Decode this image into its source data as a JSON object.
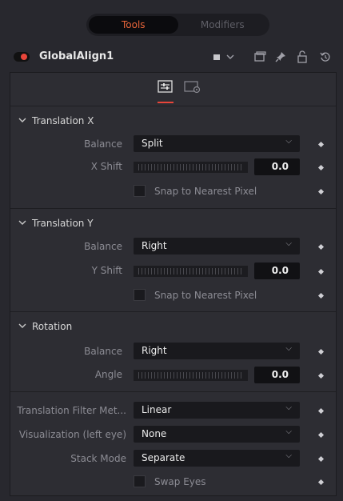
{
  "tabs": {
    "tools": "Tools",
    "modifiers": "Modifiers"
  },
  "node": {
    "name": "GlobalAlign1"
  },
  "header_icons": [
    "color-swatch-icon",
    "chevron-down-icon",
    "window-icon",
    "pin-icon",
    "lock-icon",
    "reset-icon"
  ],
  "colors": {
    "accent": "#e8453a",
    "tab_active": "#e8653a"
  },
  "sections": {
    "translation_x": {
      "title": "Translation X",
      "balance_label": "Balance",
      "balance_value": "Split",
      "shift_label": "X Shift",
      "shift_value": "0.0",
      "snap_label": "Snap to Nearest Pixel"
    },
    "translation_y": {
      "title": "Translation Y",
      "balance_label": "Balance",
      "balance_value": "Right",
      "shift_label": "Y Shift",
      "shift_value": "0.0",
      "snap_label": "Snap to Nearest Pixel"
    },
    "rotation": {
      "title": "Rotation",
      "balance_label": "Balance",
      "balance_value": "Right",
      "angle_label": "Angle",
      "angle_value": "0.0"
    }
  },
  "bottom": {
    "filter_label": "Translation Filter Met...",
    "filter_value": "Linear",
    "viz_label": "Visualization (left eye)",
    "viz_value": "None",
    "stack_label": "Stack Mode",
    "stack_value": "Separate",
    "swap_label": "Swap Eyes"
  }
}
